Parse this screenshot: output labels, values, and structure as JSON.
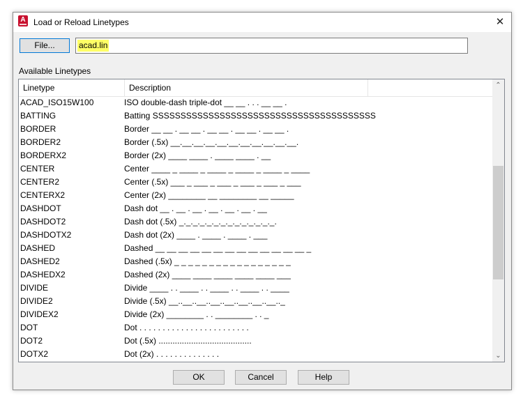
{
  "window": {
    "title": "Load or Reload Linetypes",
    "close_glyph": "✕",
    "app_icon_letter": "A"
  },
  "file": {
    "button_label": "File...",
    "value": "acad.lin"
  },
  "list": {
    "label": "Available Linetypes",
    "columns": [
      "Linetype",
      "Description"
    ],
    "rows": [
      {
        "name": "ACAD_ISO15W100",
        "desc": "ISO double-dash triple-dot __ __ . . . __ __ ."
      },
      {
        "name": "BATTING",
        "desc": "Batting SSSSSSSSSSSSSSSSSSSSSSSSSSSSSSSSSSSSSSSS"
      },
      {
        "name": "BORDER",
        "desc": "Border __ __ . __ __ . __ __ . __ __ . __ __ ."
      },
      {
        "name": "BORDER2",
        "desc": "Border (.5x) __.__.__.__.__.__.__.__.__.__.__."
      },
      {
        "name": "BORDERX2",
        "desc": "Border (2x) ____ ____ . ____ ____ . __"
      },
      {
        "name": "CENTER",
        "desc": "Center ____ _ ____ _ ____ _ ____ _ ____ _ ____"
      },
      {
        "name": "CENTER2",
        "desc": "Center (.5x) ___ _ ___ _ ___ _ ___ _ ___ _ ___"
      },
      {
        "name": "CENTERX2",
        "desc": "Center (2x) ________ __ ________ __ _____"
      },
      {
        "name": "DASHDOT",
        "desc": "Dash dot __ . __ . __ . __ . __ . __ . __"
      },
      {
        "name": "DASHDOT2",
        "desc": "Dash dot (.5x) _._._._._._._._._._._._._._."
      },
      {
        "name": "DASHDOTX2",
        "desc": "Dash dot (2x) ____ . ____ . ____ . ___"
      },
      {
        "name": "DASHED",
        "desc": "Dashed __ __ __ __ __ __ __ __ __ __ __ __ __ _"
      },
      {
        "name": "DASHED2",
        "desc": "Dashed (.5x) _ _ _ _ _ _ _ _ _ _ _ _ _ _ _ _ _"
      },
      {
        "name": "DASHEDX2",
        "desc": "Dashed (2x) ____ ____ ____ ____ ____ ___"
      },
      {
        "name": "DIVIDE",
        "desc": "Divide ____ . . ____ . . ____ . . ____ . . ____"
      },
      {
        "name": "DIVIDE2",
        "desc": "Divide (.5x) __..__..__..__..__..__..__..__.._"
      },
      {
        "name": "DIVIDEX2",
        "desc": "Divide (2x) ________ . . ________ . . _"
      },
      {
        "name": "DOT",
        "desc": "Dot . . . . . . . . . . . . . . . . . . . . . . . ."
      },
      {
        "name": "DOT2",
        "desc": "Dot (.5x) ........................................"
      },
      {
        "name": "DOTX2",
        "desc": "Dot (2x) . . . . . . . . . . . . . ."
      }
    ]
  },
  "scrollbar": {
    "up_glyph": "⌃",
    "down_glyph": "⌄"
  },
  "buttons": {
    "ok": "OK",
    "cancel": "Cancel",
    "help": "Help"
  },
  "colors": {
    "highlight": "#ffff66",
    "focus_border": "#0078d7",
    "app_icon": "#c8102e"
  }
}
